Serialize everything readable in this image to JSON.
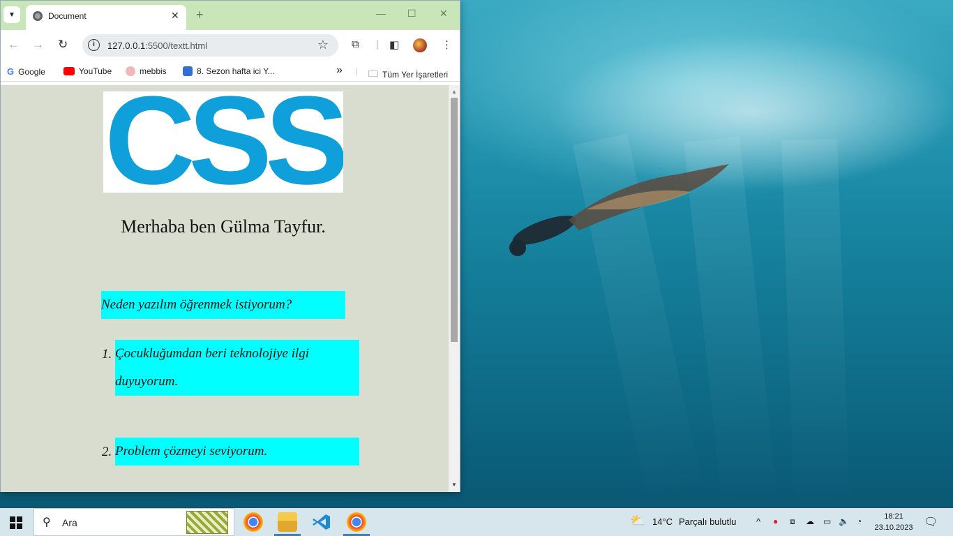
{
  "browser": {
    "tab_title": "Document",
    "url_host": "127.0.0.1",
    "url_rest": ":5500/textt.html",
    "bookmarks": [
      {
        "label": "Google"
      },
      {
        "label": "YouTube"
      },
      {
        "label": "mebbis"
      },
      {
        "label": "8. Sezon hafta ici Y..."
      }
    ],
    "bookmarks_overflow": "»",
    "all_bookmarks_label": "Tüm Yer İşaretleri"
  },
  "page": {
    "logo_text": "CSS",
    "heading": "Merhaba ben Gülma Tayfur.",
    "question": "Neden yazılım öğrenmek istiyorum?",
    "list": [
      {
        "num": "1.",
        "text": "Çocukluğumdan beri teknolojiye ilgi duyuyorum."
      },
      {
        "num": "2.",
        "text": "Problem çözmeyi seviyorum."
      }
    ],
    "colors": {
      "background": "#d9ddd0",
      "highlight": "#00ffff",
      "logo": "#0fa0dc"
    }
  },
  "taskbar": {
    "search_placeholder": "Ara",
    "weather_temp": "14°C",
    "weather_desc": "Parçalı bulutlu",
    "time": "18:21",
    "date": "23.10.2023"
  }
}
